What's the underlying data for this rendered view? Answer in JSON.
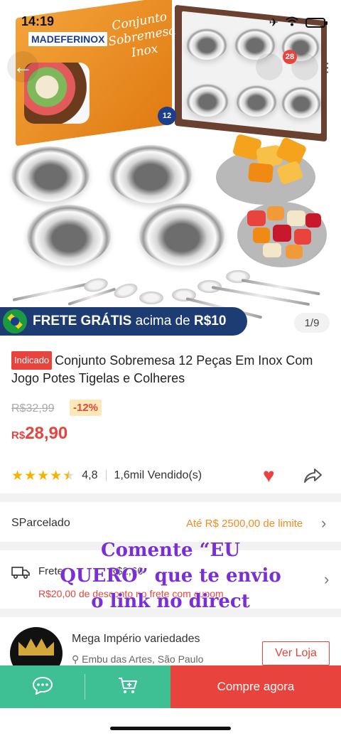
{
  "status_bar": {
    "time": "14:19"
  },
  "hero": {
    "brand_logo": "MADEFERINOX",
    "box_title": "Conjunto Sobremesa Inox",
    "box_count": "12",
    "cart_badge": "28",
    "image_counter": "1/9"
  },
  "banner": {
    "bold": "FRETE GRÁTIS",
    "rest": " acima de ",
    "amount": "R$10"
  },
  "overlay_caption": {
    "line1": "Comente “EU",
    "line2": "QUERO” que te envio",
    "line3": "o link no direct"
  },
  "product": {
    "tag": "Indicado",
    "title": "Conjunto Sobremesa 12 Peças Em Inox Com Jogo Potes Tigelas e Colheres",
    "old_price": "R$32,99",
    "discount": "-12%",
    "price_currency": "R$",
    "price_value": "28,90",
    "rating": "4,8",
    "rating_stars": 4.5,
    "sold": "1,6mil Vendido(s)"
  },
  "installments": {
    "label": "SParcelado",
    "limit": "Até R$ 2500,00 de limite"
  },
  "shipping": {
    "label": "Frete",
    "partial": "R$2,66",
    "coupon": "R$20,00 de desconto no frete com cupom"
  },
  "store": {
    "name": "Mega Império variedades",
    "location": "Embu das Artes, São Paulo",
    "visit_label": "Ver Loja"
  },
  "bottom_bar": {
    "buy_label": "Compre agora"
  },
  "colors": {
    "accent": "#e8433c",
    "green": "#3fbf94",
    "banner": "#1e3c74",
    "caption": "#7a2fd6",
    "star": "#f5b300"
  }
}
